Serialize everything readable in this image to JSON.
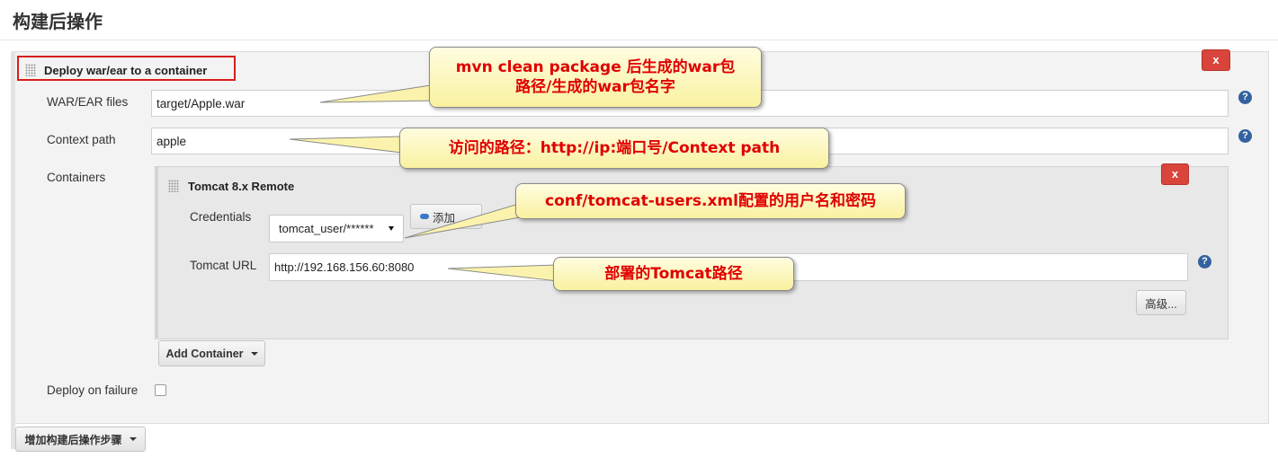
{
  "section": {
    "title": "构建后操作"
  },
  "deploy": {
    "title": "Deploy war/ear to a container",
    "delete_label": "x",
    "war_files": {
      "label": "WAR/EAR files",
      "value": "target/Apple.war"
    },
    "context_path": {
      "label": "Context path",
      "value": "apple"
    },
    "containers_label": "Containers",
    "deploy_on_failure": {
      "label": "Deploy on failure",
      "checked": false
    }
  },
  "container": {
    "title": "Tomcat 8.x Remote",
    "delete_label": "x",
    "credentials": {
      "label": "Credentials",
      "selected": "tomcat_user/******",
      "add_label": "添加"
    },
    "url": {
      "label": "Tomcat URL",
      "value": "http://192.168.156.60:8080"
    },
    "advanced_label": "高级..."
  },
  "add_container_label": "Add Container",
  "add_post_build_label": "增加构建后操作步骤",
  "help_glyph": "?",
  "callouts": {
    "war": {
      "line1": "mvn clean package 后生成的war包",
      "line2": "路径/生成的war包名字"
    },
    "context": "访问的路径：http://ip:端口号/Context path",
    "credentials": "conf/tomcat-users.xml配置的用户名和密码",
    "tomcat": "部署的Tomcat路径"
  },
  "colors": {
    "delete": "#d9453b",
    "highlight": "#d91c1c",
    "callout_text": "#e00000",
    "help": "#34629e"
  }
}
